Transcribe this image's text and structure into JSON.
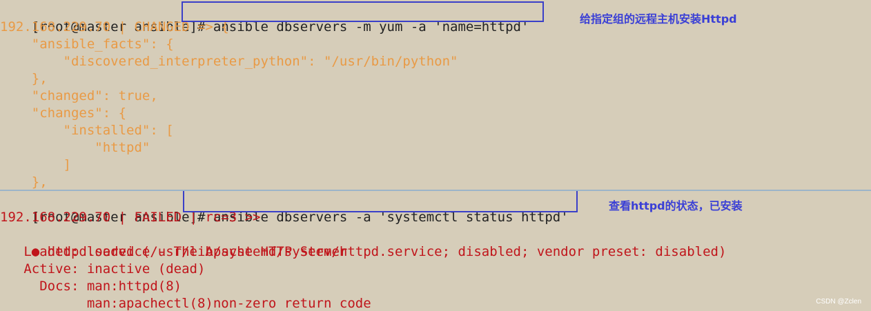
{
  "top_terminal": {
    "prompt": "[root@master ansible]#",
    "command": " ansible dbservers -m yum -a 'name=httpd'",
    "annotation": "给指定组的远程主机安装Httpd",
    "output": [
      "192.168.229.70 | CHANGED => {",
      "    \"ansible_facts\": {",
      "        \"discovered_interpreter_python\": \"/usr/bin/python\"",
      "    },",
      "    \"changed\": true,",
      "    \"changes\": {",
      "        \"installed\": [",
      "            \"httpd\"",
      "        ]",
      "    },"
    ]
  },
  "bottom_terminal": {
    "prompt": "[root@master ansible]#",
    "command": " ansible dbservers -a 'systemctl status httpd'",
    "annotation": "查看httpd的状态，已安装",
    "output": [
      "192.168.229.70 | FAILED | rc=3 >>",
      " httpd.service - The Apache HTTP Server",
      "   Loaded: loaded (/usr/lib/systemd/system/httpd.service; disabled; vendor preset: disabled)",
      "   Active: inactive (dead)",
      "     Docs: man:httpd(8)",
      "           man:apachectl(8)non-zero return code"
    ],
    "status_dot": "●"
  },
  "watermark": "CSDN @Zclen",
  "colors": {
    "background": "#d6cdb9",
    "orange_text": "#e99a45",
    "red_text": "#c0151b",
    "annotation_blue": "#3a3fd6",
    "box_border": "#3a3fc8"
  }
}
